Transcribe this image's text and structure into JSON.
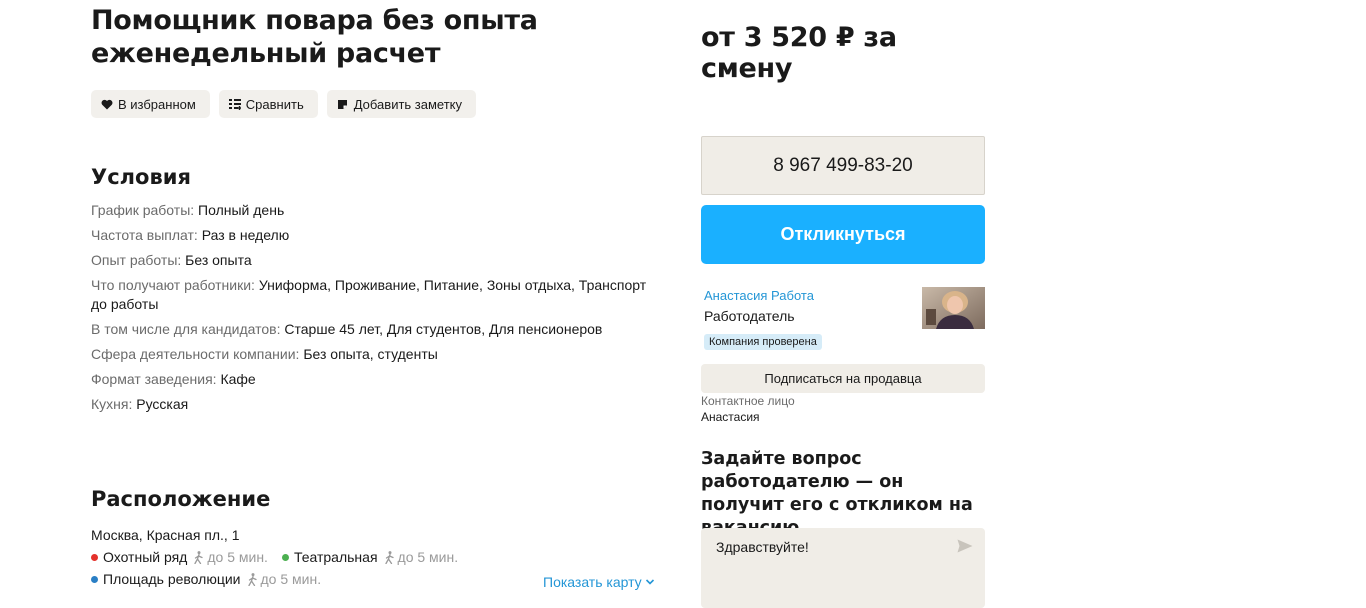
{
  "vacancy": {
    "title_line1": "Помощник повара без опыта",
    "title_line2": "еженедельный расчет",
    "price": "от 3 520 ₽ за смену"
  },
  "actions": [
    {
      "label": "В избранном",
      "icon": "heart-icon"
    },
    {
      "label": "Сравнить",
      "icon": "compare-icon"
    },
    {
      "label": "Добавить заметку",
      "icon": "note-icon"
    }
  ],
  "conditions": {
    "title": "Условия",
    "rows": [
      {
        "label": "График работы:",
        "value": "Полный день"
      },
      {
        "label": "Частота выплат:",
        "value": "Раз в неделю"
      },
      {
        "label": "Опыт работы:",
        "value": "Без опыта"
      },
      {
        "label": "Что получают работники:",
        "value": "Униформа, Проживание, Питание, Зоны отдыха, Транспорт до работы"
      },
      {
        "label": "В том числе для кандидатов:",
        "value": "Старше 45 лет, Для студентов, Для пенсионеров"
      },
      {
        "label": "Сфера деятельности компании:",
        "value": "Без опыта, студенты"
      },
      {
        "label": "Формат заведения:",
        "value": "Кафе"
      },
      {
        "label": "Кухня:",
        "value": "Русская"
      }
    ]
  },
  "location": {
    "title": "Расположение",
    "address": "Москва, Красная пл., 1",
    "metro": [
      {
        "name": "Охотный ряд",
        "walk": "до 5 мин.",
        "color": "#e4312b"
      },
      {
        "name": "Театральная",
        "walk": "до 5 мин.",
        "color": "#4cb051"
      },
      {
        "name": "Площадь революции",
        "walk": "до 5 мин.",
        "color": "#2a7fc5"
      }
    ],
    "show_map": "Показать карту"
  },
  "contact": {
    "phone": "8 967 499-83-20",
    "respond_label": "Откликнуться",
    "employer_name": "Анастасия Работа",
    "employer_role": "Работодатель",
    "verified_badge": "Компания проверена",
    "subscribe_label": "Подписаться на продавца",
    "contact_person_label": "Контактное лицо",
    "contact_person_name": "Анастасия"
  },
  "question": {
    "title": "Задайте вопрос работодателю — он получит его с откликом на вакансию",
    "message_value": "Здравствуйте!"
  },
  "colors": {
    "accent": "#1ab0ff",
    "link": "#2496d6",
    "chip_bg": "#f2f0ec"
  }
}
